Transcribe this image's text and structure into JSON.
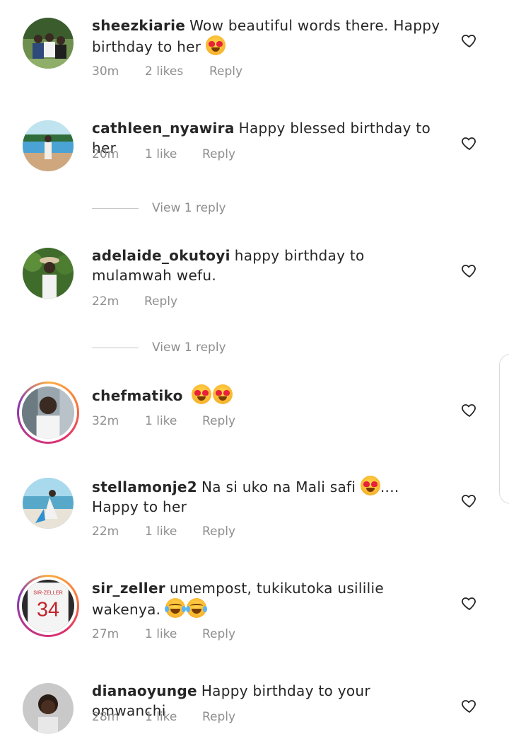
{
  "comments": [
    {
      "username": "sheezkiarie",
      "text": "Wow beautiful words there. Happy birthday to her",
      "emojis": [
        "heart-eyes"
      ],
      "time": "30m",
      "likes": "2 likes",
      "reply": "Reply",
      "avatar_colors": [
        "#3b5d2e",
        "#8fae6a"
      ]
    },
    {
      "username": "cathleen_nyawira",
      "text": "Happy blessed birthday to her",
      "emojis": [],
      "time": "20m",
      "likes": "1 like",
      "reply": "Reply",
      "view_replies": "View 1 reply",
      "avatar_colors": [
        "#7fc3d9",
        "#cfa77e"
      ]
    },
    {
      "username": "adelaide_okutoyi",
      "text": "happy birthday to mulamwah wefu.",
      "emojis": [],
      "time": "22m",
      "likes": "",
      "reply": "Reply",
      "view_replies": "View 1 reply",
      "avatar_colors": [
        "#3f6b2b",
        "#d9c7a5"
      ]
    },
    {
      "username": "chefmatiko",
      "text": "",
      "emojis": [
        "heart-eyes",
        "heart-eyes"
      ],
      "time": "32m",
      "likes": "1 like",
      "reply": "Reply",
      "avatar_colors": [
        "#9aa6ad",
        "#3a2a22"
      ]
    },
    {
      "username": "stellamonje2",
      "text": "Na si uko na Mali safi",
      "text_after": ".... Happy to her",
      "emojis": [
        "heart-eyes"
      ],
      "time": "22m",
      "likes": "1 like",
      "reply": "Reply",
      "avatar_colors": [
        "#58a9c9",
        "#e8e3d6"
      ]
    },
    {
      "username": "sir_zeller",
      "text": "umempost, tukikutoka usililie wakenya.",
      "emojis": [
        "tears-of-joy",
        "tears-of-joy"
      ],
      "time": "27m",
      "likes": "1 like",
      "reply": "Reply",
      "jersey_number": "34",
      "jersey_name": "SIR-ZELLER",
      "avatar_colors": [
        "#f4f4f4",
        "#c0262c"
      ]
    },
    {
      "username": "dianaoyunge",
      "text": "Happy birthday to your omwanchi",
      "emojis": [],
      "time": "28m",
      "likes": "1 like",
      "reply": "Reply",
      "avatar_colors": [
        "#c9c9c9",
        "#2a1c14"
      ]
    }
  ],
  "colors": {
    "text": "#262626",
    "meta": "#8e8e8e",
    "story_ring": [
      "#fcaf45",
      "#e1306c",
      "#833ab4"
    ]
  },
  "icons": {
    "like": "heart-outline-icon"
  }
}
